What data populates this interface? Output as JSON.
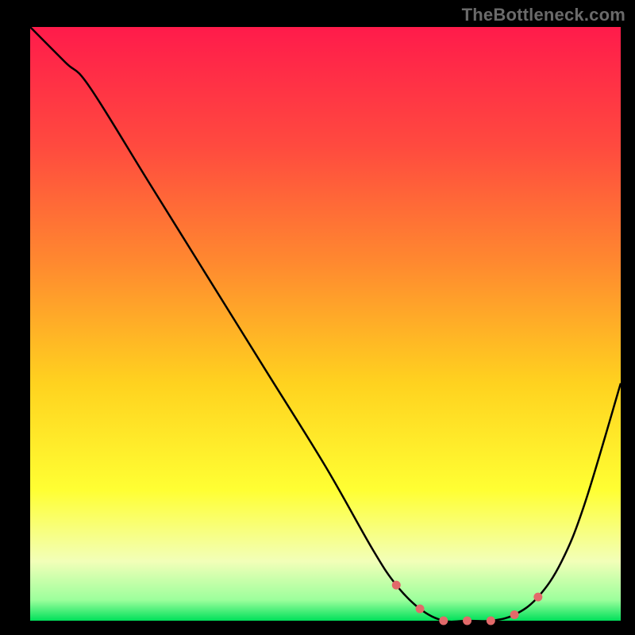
{
  "watermark": "TheBottleneck.com",
  "colors": {
    "background": "#000000",
    "watermark": "#6a6a6a",
    "curve": "#000000",
    "dots": "#e26a6a",
    "gradient_stops": [
      {
        "offset": 0.0,
        "color": "#ff1b4b"
      },
      {
        "offset": 0.2,
        "color": "#ff4a3f"
      },
      {
        "offset": 0.4,
        "color": "#ff8a2f"
      },
      {
        "offset": 0.6,
        "color": "#ffd21f"
      },
      {
        "offset": 0.78,
        "color": "#ffff33"
      },
      {
        "offset": 0.9,
        "color": "#f2ffb8"
      },
      {
        "offset": 0.965,
        "color": "#9cff9c"
      },
      {
        "offset": 1.0,
        "color": "#00e05a"
      }
    ]
  },
  "chart_data": {
    "type": "line",
    "title": "",
    "xlabel": "",
    "ylabel": "",
    "xlim": [
      0,
      100
    ],
    "ylim": [
      0,
      100
    ],
    "grid": false,
    "legend": false,
    "x": [
      0,
      6,
      10,
      20,
      30,
      40,
      50,
      58,
      62,
      66,
      70,
      74,
      78,
      82,
      86,
      90,
      94,
      100
    ],
    "values": [
      100,
      94,
      90,
      74,
      58,
      42,
      26,
      12,
      6,
      2,
      0,
      0,
      0,
      1,
      4,
      10,
      20,
      40
    ],
    "dot_indices": [
      8,
      9,
      10,
      11,
      12,
      13,
      14
    ]
  }
}
